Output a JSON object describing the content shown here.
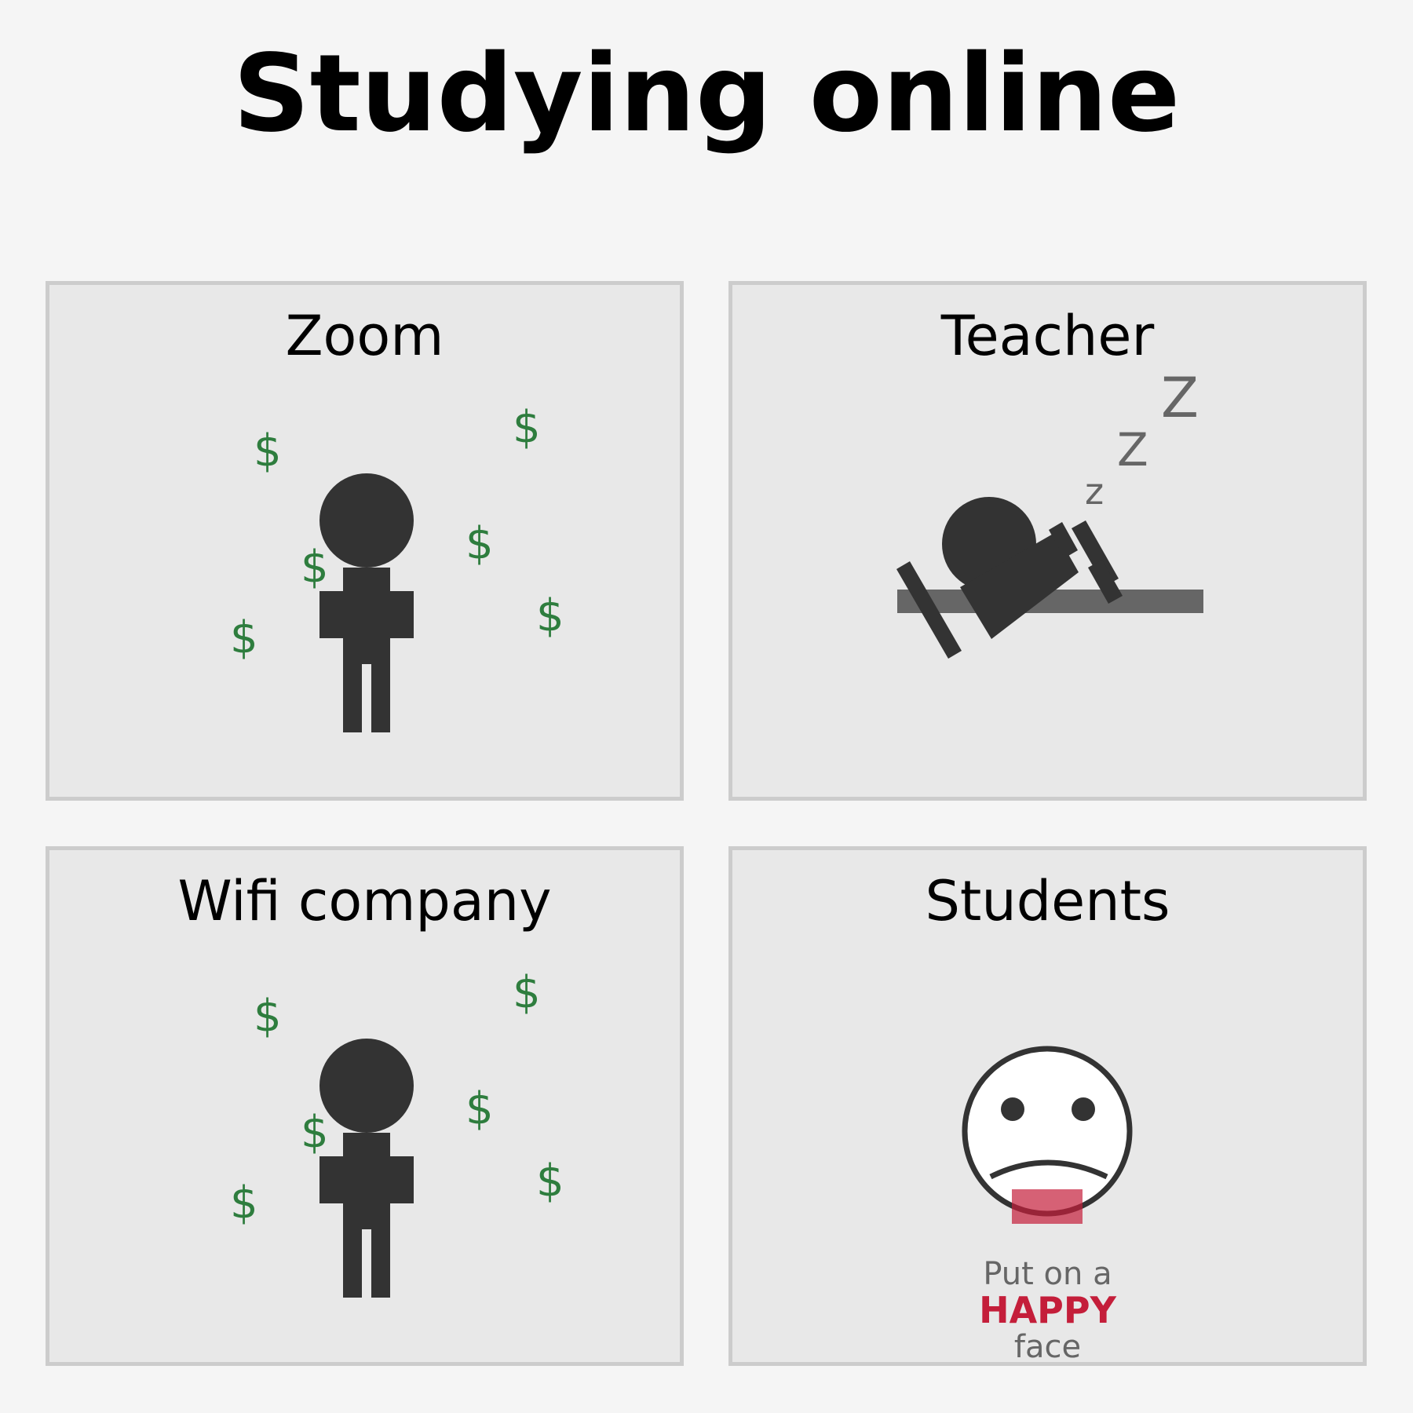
{
  "title": "Studying online",
  "panels": [
    {
      "label": "Zoom",
      "figure": "person-with-money-icon",
      "money_symbol": "$"
    },
    {
      "label": "Teacher",
      "figure": "sleeping-person-icon",
      "sleep_letters": [
        "z",
        "Z",
        "Z"
      ]
    },
    {
      "label": "Wifi company",
      "figure": "person-with-money-icon",
      "money_symbol": "$"
    },
    {
      "label": "Students",
      "figure": "sad-face-icon",
      "caption": [
        "Put on a",
        "HAPPY",
        "face"
      ]
    }
  ],
  "colors": {
    "background": "#f5f5f5",
    "panel": "#e8e8e8",
    "panel_border": "#cccccc",
    "figure": "#333333",
    "money": "#2e7d3e",
    "accent": "#c41e3a",
    "muted": "#666666"
  }
}
